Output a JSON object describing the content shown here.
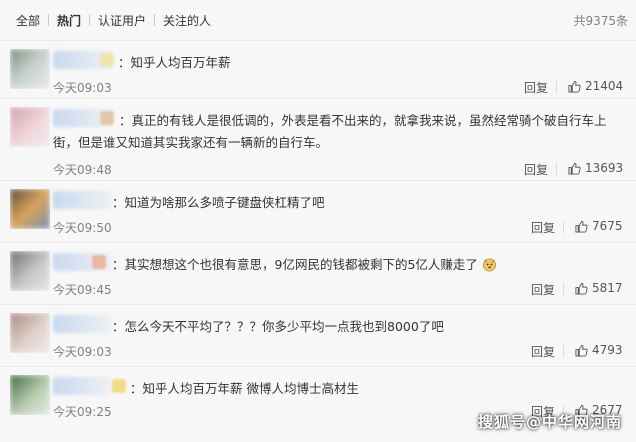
{
  "tabs": [
    {
      "label": "全部"
    },
    {
      "label": "热门"
    },
    {
      "label": "认证用户"
    },
    {
      "label": "关注的人"
    }
  ],
  "total_count": "共9375条",
  "reply_label": "回复",
  "comments": [
    {
      "text": "知乎人均百万年薪",
      "time": "今天09:03",
      "likes": "21404",
      "avatar_colors": [
        "#7b8f7d",
        "#c9d2cf"
      ]
    },
    {
      "text": "真正的有钱人是很低调的，外表是看不出来的，就拿我来说，虽然经常骑个破自行车上街，但是谁又知道其实我家还有一辆新的自行车。",
      "time": "今天09:48",
      "likes": "13693",
      "avatar_colors": [
        "#d4a0a8",
        "#efd7dc"
      ]
    },
    {
      "text": "知道为啥那么多喷子键盘侠杠精了吧",
      "time": "今天09:50",
      "likes": "7675",
      "avatar_colors": [
        "#5c4b3a",
        "#d9a35c"
      ]
    },
    {
      "text": "其实想想这个也很有意思，9亿网民的钱都被剩下的5亿人赚走了",
      "time": "今天09:45",
      "likes": "5817",
      "avatar_colors": [
        "#6e6e6e",
        "#c8c8c8"
      ]
    },
    {
      "text": "怎么今天不平均了？？？你多少平均一点我也到8000了吧",
      "time": "今天09:03",
      "likes": "4793",
      "avatar_colors": [
        "#a58a80",
        "#e0d2cc"
      ]
    },
    {
      "text": "知乎人均百万年薪 微博人均博士高材生",
      "time": "今天09:25",
      "likes": "2677",
      "avatar_colors": [
        "#3f6b3f",
        "#b8ccb0"
      ]
    }
  ],
  "watermark": "搜狐号@中华网河南"
}
